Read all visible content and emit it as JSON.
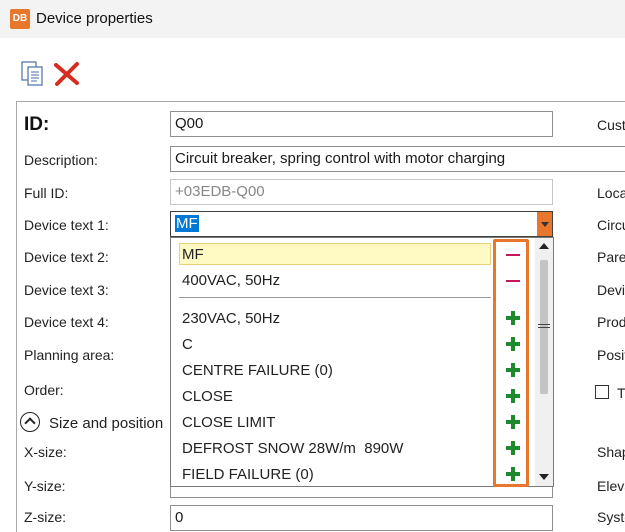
{
  "window": {
    "title": "Device properties",
    "logo": "DB"
  },
  "toolbar": {
    "copy_icon": "copy-document-icon",
    "delete_icon": "red-x-delete-icon"
  },
  "form": {
    "id_label": "ID:",
    "id_value": "Q00",
    "description_label": "Description:",
    "description_value": "Circuit breaker, spring control with motor charging",
    "full_id_label": "Full ID:",
    "full_id_value": "+03EDB-Q00",
    "device_text1_label": "Device text 1:",
    "device_text1_value": "MF",
    "device_text2_label": "Device text 2:",
    "device_text3_label": "Device text 3:",
    "device_text4_label": "Device text 4:",
    "planning_area_label": "Planning area:",
    "order_label": "Order:",
    "size_position_label": "Size and position",
    "xsize_label": "X-size:",
    "ysize_label": "Y-size:",
    "zsize_label": "Z-size:",
    "zsize_value": "0"
  },
  "right_column": {
    "cust": "Cust",
    "loca": "Loca",
    "circu": "Circu",
    "pare": "Pare",
    "devi": "Devi",
    "prod": "Prod",
    "posit": "Posit",
    "checkbox_label": "T",
    "shap": "Shap",
    "eleva": "Eleva",
    "syste": "Syste"
  },
  "dropdown": {
    "items": [
      {
        "label": "MF",
        "action": "remove",
        "highlighted": true
      },
      {
        "label": "400VAC, 50Hz",
        "action": "remove"
      },
      {
        "label": "230VAC, 50Hz",
        "action": "add"
      },
      {
        "label": "C",
        "action": "add"
      },
      {
        "label": "CENTRE FAILURE (0)",
        "action": "add"
      },
      {
        "label": "CLOSE",
        "action": "add"
      },
      {
        "label": "CLOSE LIMIT",
        "action": "add"
      },
      {
        "label": "DEFROST SNOW 28W/m  890W",
        "action": "add"
      },
      {
        "label": "FIELD FAILURE (0)",
        "action": "add"
      }
    ]
  },
  "colors": {
    "accent": "#e8762c",
    "remove": "#c2185b",
    "add": "#1e8a2e",
    "selection": "#0078d7"
  }
}
